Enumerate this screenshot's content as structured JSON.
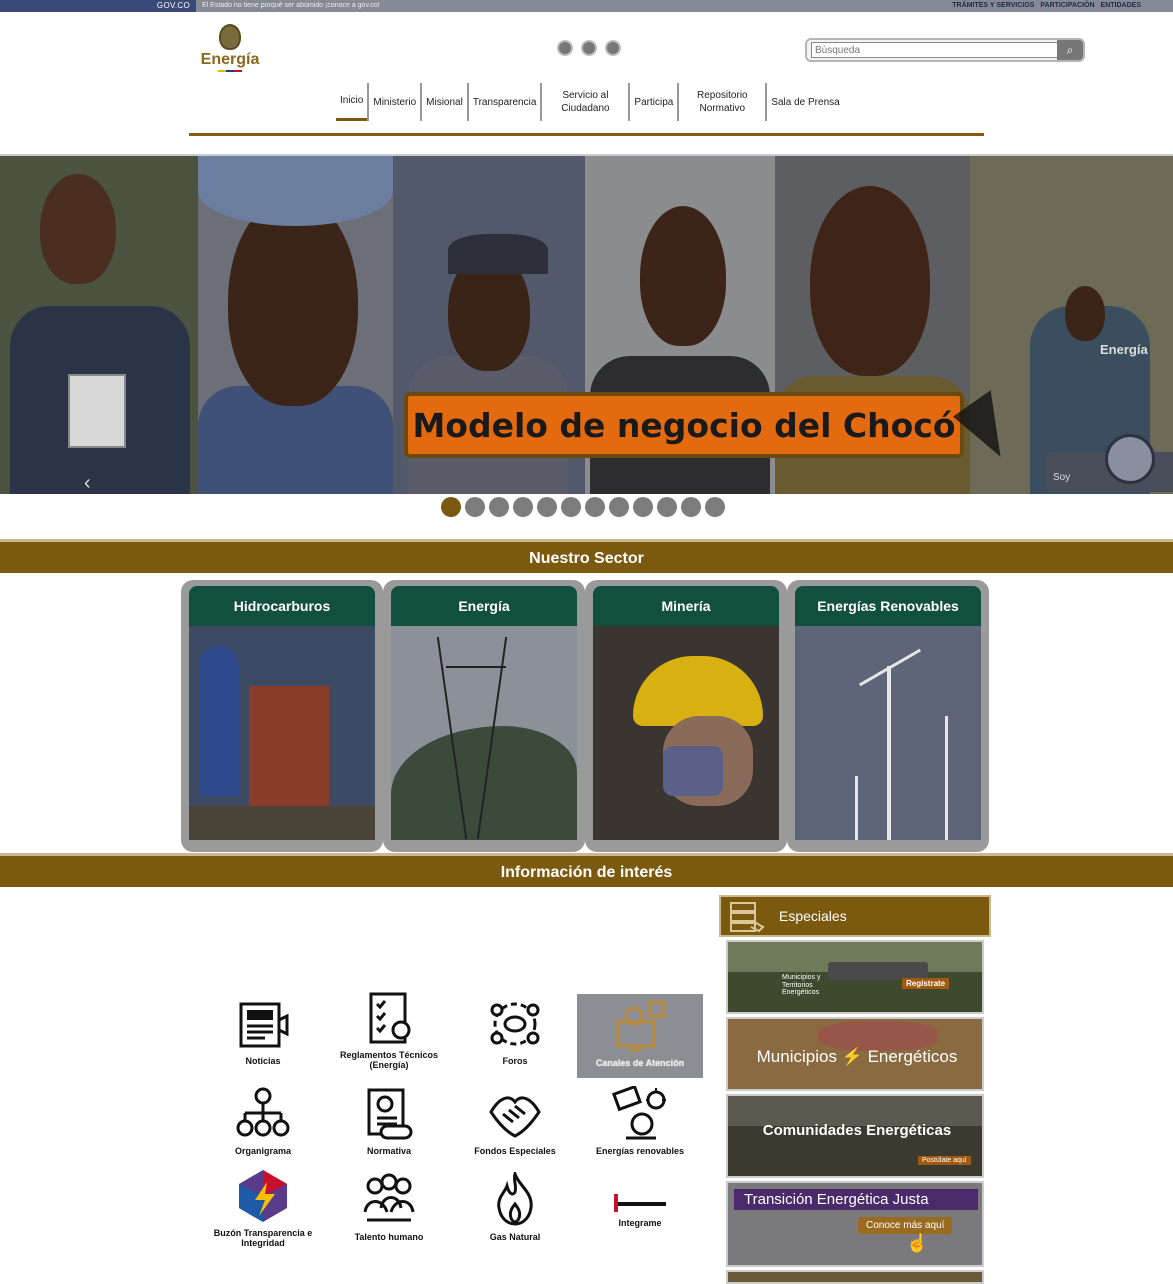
{
  "govbar": {
    "brand": "GOV.CO",
    "tagline": "El Estado no tiene porqué ser abúmido ¡conoce a gov.co!",
    "links": [
      "TRÁMITES Y SERVICIOS",
      "PARTICIPACIÓN",
      "ENTIDADES"
    ]
  },
  "header": {
    "logo_text": "Energía",
    "search_placeholder": "Búsqueda",
    "accessibility_icons": [
      "accessibility-icon",
      "contrast-icon",
      "text-size-icon"
    ]
  },
  "nav": [
    {
      "label": "Inicio"
    },
    {
      "label": "Ministerio"
    },
    {
      "label": "Misional"
    },
    {
      "label": "Transparencia"
    },
    {
      "label": "Servicio al Ciudadano"
    },
    {
      "label": "Participa"
    },
    {
      "label": "Repositorio Normativo"
    },
    {
      "label": "Sala de Prensa"
    }
  ],
  "hero": {
    "banner": "Modelo de negocio del Chocó",
    "logo": "Energía",
    "chat_label": "Soy",
    "slide_count": 12,
    "active_slide": 1
  },
  "sector": {
    "title": "Nuestro Sector",
    "cards": [
      {
        "label": "Hidrocarburos"
      },
      {
        "label": "Energía"
      },
      {
        "label": "Minería"
      },
      {
        "label": "Energías Renovables"
      }
    ]
  },
  "info": {
    "title": "Información de interés",
    "items": [
      {
        "label": "Noticias"
      },
      {
        "label": "Reglamentos Técnicos (Energía)"
      },
      {
        "label": "Foros"
      },
      {
        "label": "Canales de Atención"
      },
      {
        "label": "Organigrama"
      },
      {
        "label": "Normativa"
      },
      {
        "label": "Fondos Especiales"
      },
      {
        "label": "Energías renovables"
      },
      {
        "label": "Buzón Transparencia e Integridad"
      },
      {
        "label": "Talento humano"
      },
      {
        "label": "Gas Natural"
      },
      {
        "label": "Integrame"
      }
    ]
  },
  "especiales": {
    "title": "Especiales",
    "tiles": [
      {
        "text": "Municipios y Territorios Energéticos",
        "cta": "Regístrate"
      },
      {
        "text": "Municipios ⚡ Energéticos"
      },
      {
        "text": "Comunidades Energéticas",
        "cta": "Postúlate aquí"
      },
      {
        "text": "Transición Energética Justa",
        "cta": "Conoce más aquí"
      }
    ]
  },
  "colors": {
    "brand_gold": "#7b5a10",
    "card_green": "#12503e",
    "banner_orange": "#e46a10"
  }
}
